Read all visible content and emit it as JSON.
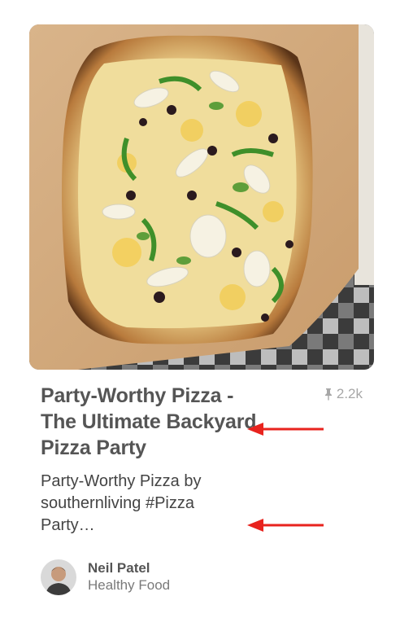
{
  "pin": {
    "image_alt": "Rectangular pizza with onions, olives, green peppers and potato slices on a wooden peel",
    "title": "Party-Worthy Pizza - The Ultimate Backyard Pizza Party",
    "save_count": "2.2k",
    "description": "Party-Worthy Pizza by southernliving #Pizza Party…"
  },
  "attribution": {
    "author": "Neil Patel",
    "board": "Healthy Food"
  },
  "colors": {
    "title": "#555555",
    "muted": "#a7a7a7",
    "annotation_arrow": "#e8231e"
  },
  "icons": {
    "save": "pushpin-icon"
  }
}
